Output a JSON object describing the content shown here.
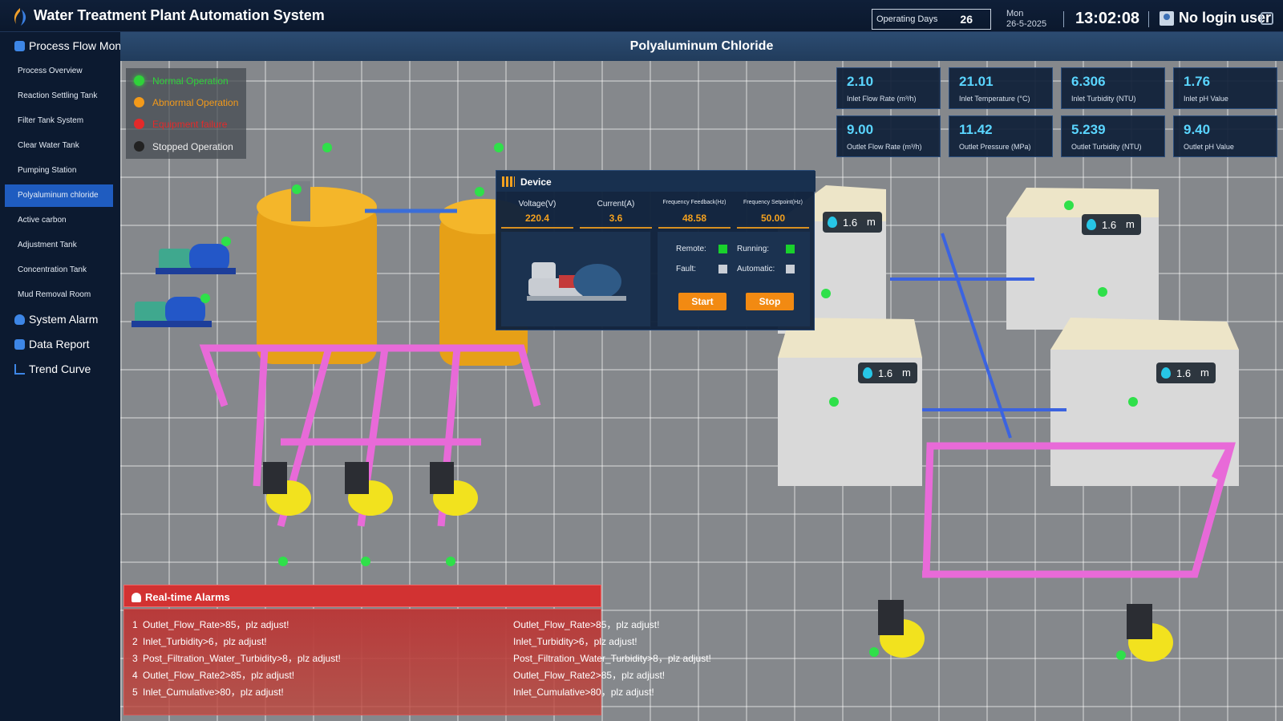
{
  "app": {
    "title": "Water Treatment Plant Automation System"
  },
  "header": {
    "operating_days_label": "Operating Days",
    "operating_days_value": "26",
    "day": "Mon",
    "date": "26-5-2025",
    "time": "13:02:08",
    "user_label": "No login user"
  },
  "sidebar": {
    "process_flow_label": "Process Flow Mon",
    "items": [
      {
        "label": "Process Overview"
      },
      {
        "label": "Reaction Settling Tank"
      },
      {
        "label": "Filter Tank System"
      },
      {
        "label": "Clear Water Tank"
      },
      {
        "label": "Pumping Station"
      },
      {
        "label": "Polyaluminum chloride"
      },
      {
        "label": "Active carbon"
      },
      {
        "label": "Adjustment Tank"
      },
      {
        "label": "Concentration Tank"
      },
      {
        "label": "Mud Removal Room"
      }
    ],
    "active_item": "Polyaluminum chloride",
    "system_alarm_label": "System Alarm",
    "data_report_label": "Data Report",
    "trend_curve_label": "Trend Curve"
  },
  "page": {
    "title": "Polyaluminum Chloride"
  },
  "legend": [
    {
      "label": "Normal Operation",
      "color": "#2fd23a"
    },
    {
      "label": "Abnormal Operation",
      "color": "#f39a1a"
    },
    {
      "label": "Equipment failure",
      "color": "#e42a2a"
    },
    {
      "label": "Stopped Operation",
      "color": "#222222"
    }
  ],
  "metrics": {
    "inlet": [
      {
        "value": "2.10",
        "label": "Inlet Flow Rate (m³/h)"
      },
      {
        "value": "21.01",
        "label": "Inlet Temperature (°C)"
      },
      {
        "value": "6.306",
        "label": "Inlet Turbidity (NTU)"
      },
      {
        "value": "1.76",
        "label": "Inlet pH Value"
      }
    ],
    "outlet": [
      {
        "value": "9.00",
        "label": "Outlet Flow Rate (m³/h)"
      },
      {
        "value": "11.42",
        "label": "Outlet Pressure (MPa)"
      },
      {
        "value": "5.239",
        "label": "Outlet Turbidity (NTU)"
      },
      {
        "value": "9.40",
        "label": "Outlet pH Value"
      }
    ]
  },
  "device": {
    "title": "Device",
    "voltage_label": "Voltage(V)",
    "voltage": "220.4",
    "current_label": "Current(A)",
    "current": "3.6",
    "freq_feedback_label": "Frequency Feedback(Hz)",
    "freq_feedback": "48.58",
    "freq_setpoint_label": "Frequency Setpoint(Hz)",
    "freq_setpoint": "50.00",
    "remote_label": "Remote:",
    "running_label": "Running:",
    "fault_label": "Fault:",
    "automatic_label": "Automatic:",
    "remote_on": true,
    "running_on": true,
    "fault_on": false,
    "automatic_on": false,
    "start_label": "Start",
    "stop_label": "Stop"
  },
  "tank_levels": [
    "1.6",
    "1.6",
    "1.6",
    "1.6"
  ],
  "tank_level_unit": "m",
  "alarms": {
    "title": "Real-time Alarms",
    "items": [
      {
        "n": "1",
        "text": "Outlet_Flow_Rate>85，plz adjust!"
      },
      {
        "n": "2",
        "text": "Inlet_Turbidity>6，plz adjust!"
      },
      {
        "n": "3",
        "text": "Post_Filtration_Water_Turbidity>8，plz adjust!"
      },
      {
        "n": "4",
        "text": "Outlet_Flow_Rate2>85，plz adjust!"
      },
      {
        "n": "5",
        "text": "Inlet_Cumulative>80，plz adjust!"
      }
    ],
    "scroll_items": [
      "Outlet_Flow_Rate>85，plz adjust!",
      "Inlet_Turbidity>6，plz adjust!",
      "Post_Filtration_Water_Turbidity>8，plz adjust!",
      "Outlet_Flow_Rate2>85，plz adjust!",
      "Inlet_Cumulative>80，plz adjust!"
    ]
  }
}
